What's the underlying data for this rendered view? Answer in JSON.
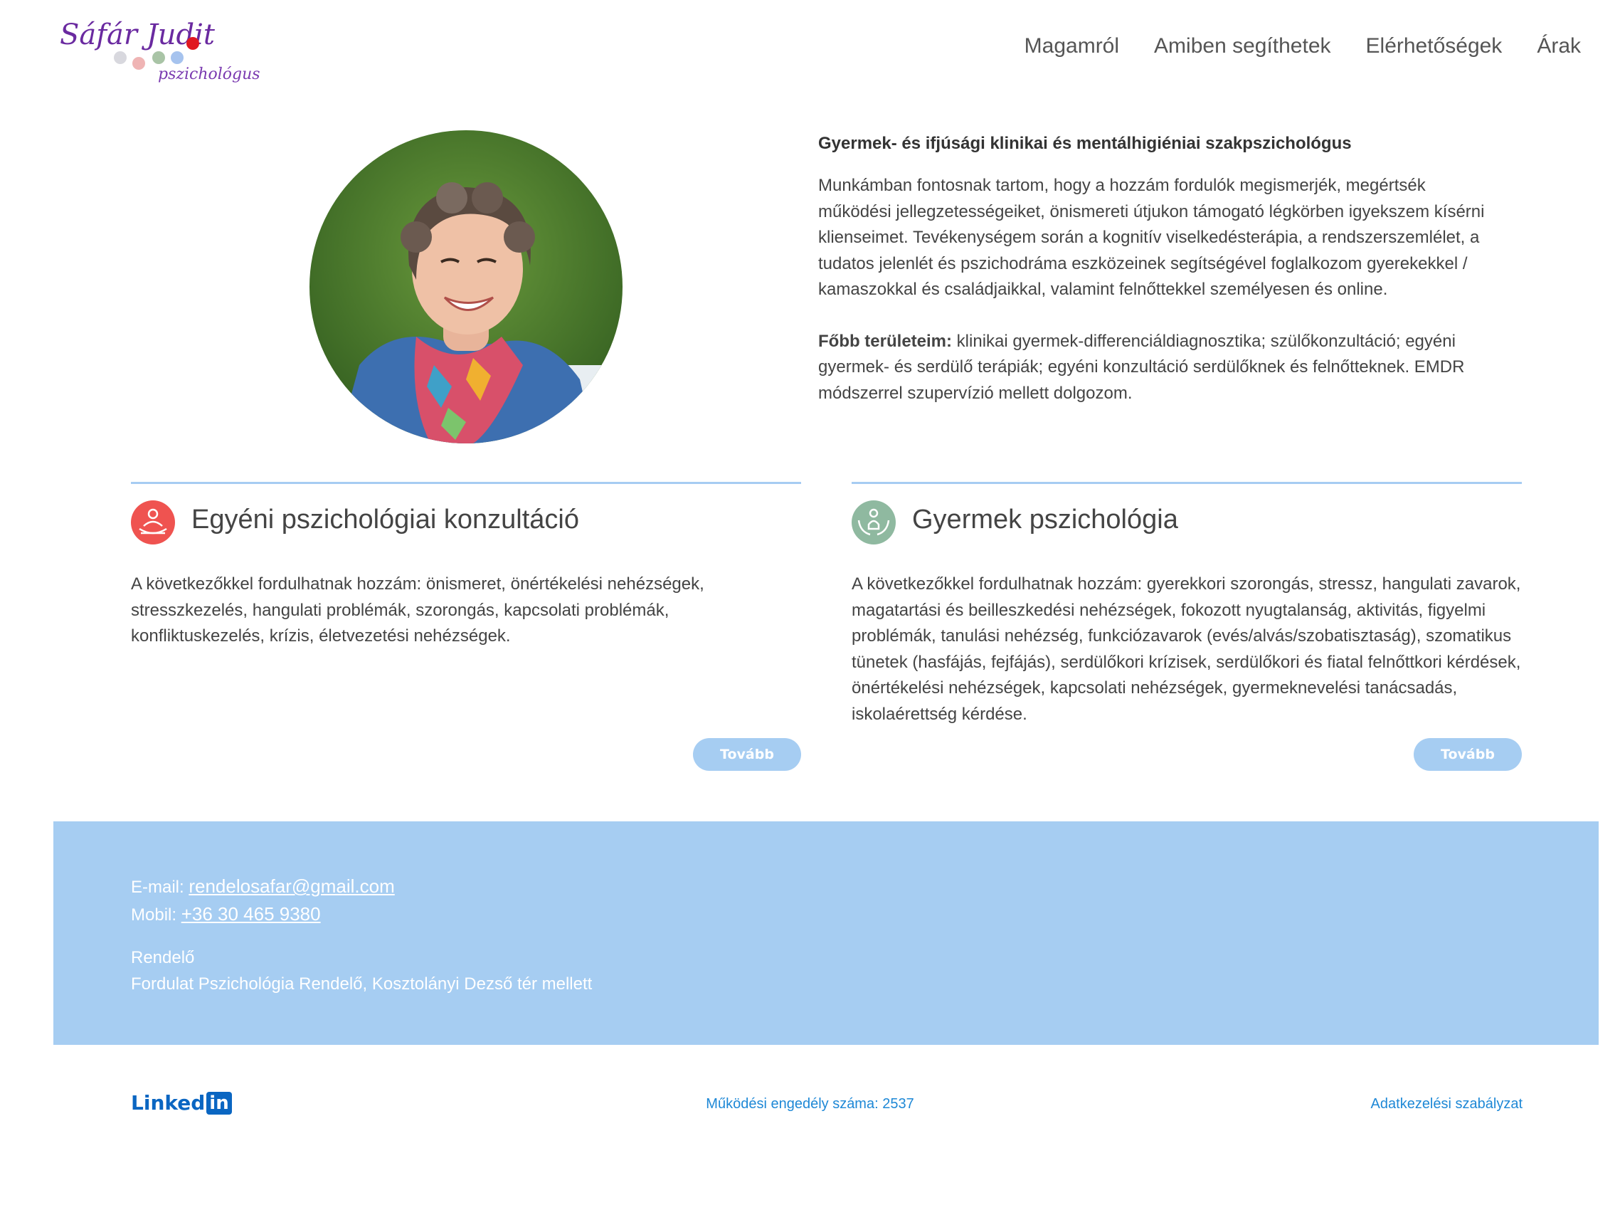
{
  "header": {
    "logo_name": "Sáfár Judit",
    "logo_sub": "pszichológus",
    "nav": [
      "Magamról",
      "Amiben segíthetek",
      "Elérhetőségek",
      "Árak"
    ]
  },
  "intro": {
    "title": "Gyermek- és ifjúsági klinikai és mentálhigiéniai szakpszichológus",
    "paragraph": "Munkámban fontosnak tartom, hogy a hozzám fordulók megismerjék, megértsék működési jellegzetességeiket, önismereti útjukon támogató légkörben igyekszem kísérni klienseimet. Tevékenységem során a kognitív viselkedésterápia, a rendszerszemlélet, a tudatos jelenlét és pszichodráma eszközeinek segítségével foglalkozom gyerekekkel / kamaszokkal és családjaikkal, valamint felnőttekkel személyesen és online.",
    "areas_label": "Főbb területeim:",
    "areas_text": " klinikai gyermek-differenciáldiagnosztika; szülőkonzultáció; egyéni gyermek- és serdülő terápiák; egyéni konzultáció serdülőknek és felnőtteknek. EMDR módszerrel szupervízió mellett dolgozom."
  },
  "cards": [
    {
      "title": "Egyéni pszichológiai konzultáció",
      "text": "A következőkkel fordulhatnak hozzám: önismeret, önértékelési nehézségek, stresszkezelés, hangulati problémák, szorongás, kapcsolati problémák, konfliktuskezelés, krízis, életvezetési nehézségek.",
      "button": "Tovább",
      "icon_color": "#ef5350"
    },
    {
      "title": "Gyermek pszichológia",
      "text": "A következőkkel fordulhatnak hozzám: gyerekkori szorongás, stressz, hangulati zavarok, magatartási és beilleszkedési nehézségek, fokozott nyugtalanság, aktivitás, figyelmi problémák, tanulási nehézség, funkciózavarok (evés/alvás/szobatisztaság), szomatikus tünetek (hasfájás, fejfájás), serdülőkori krízisek, serdülőkori és fiatal felnőttkori kérdések, önértékelési nehézségek, kapcsolati nehézségek, gyermeknevelési tanácsadás, iskolaérettség kérdése.",
      "button": "Tovább",
      "icon_color": "#8fb9a0"
    }
  ],
  "contact": {
    "email_label": "E-mail: ",
    "email": "rendelosafar@gmail.com",
    "phone_label": "Mobil: ",
    "phone": "+36 30 465 9380",
    "office_label": "Rendelő",
    "office_address": "Fordulat Pszichológia Rendelő, Kosztolányi Dezső tér mellett"
  },
  "footer": {
    "linkedin_a": "Linked",
    "linkedin_b": "in",
    "license": "Működési engedély száma: 2537",
    "privacy": "Adatkezelési szabályzat"
  },
  "colors": {
    "accent_blue": "#a6cdf2",
    "link_blue": "#1e88d6",
    "logo_purple": "#6a2aa0"
  }
}
